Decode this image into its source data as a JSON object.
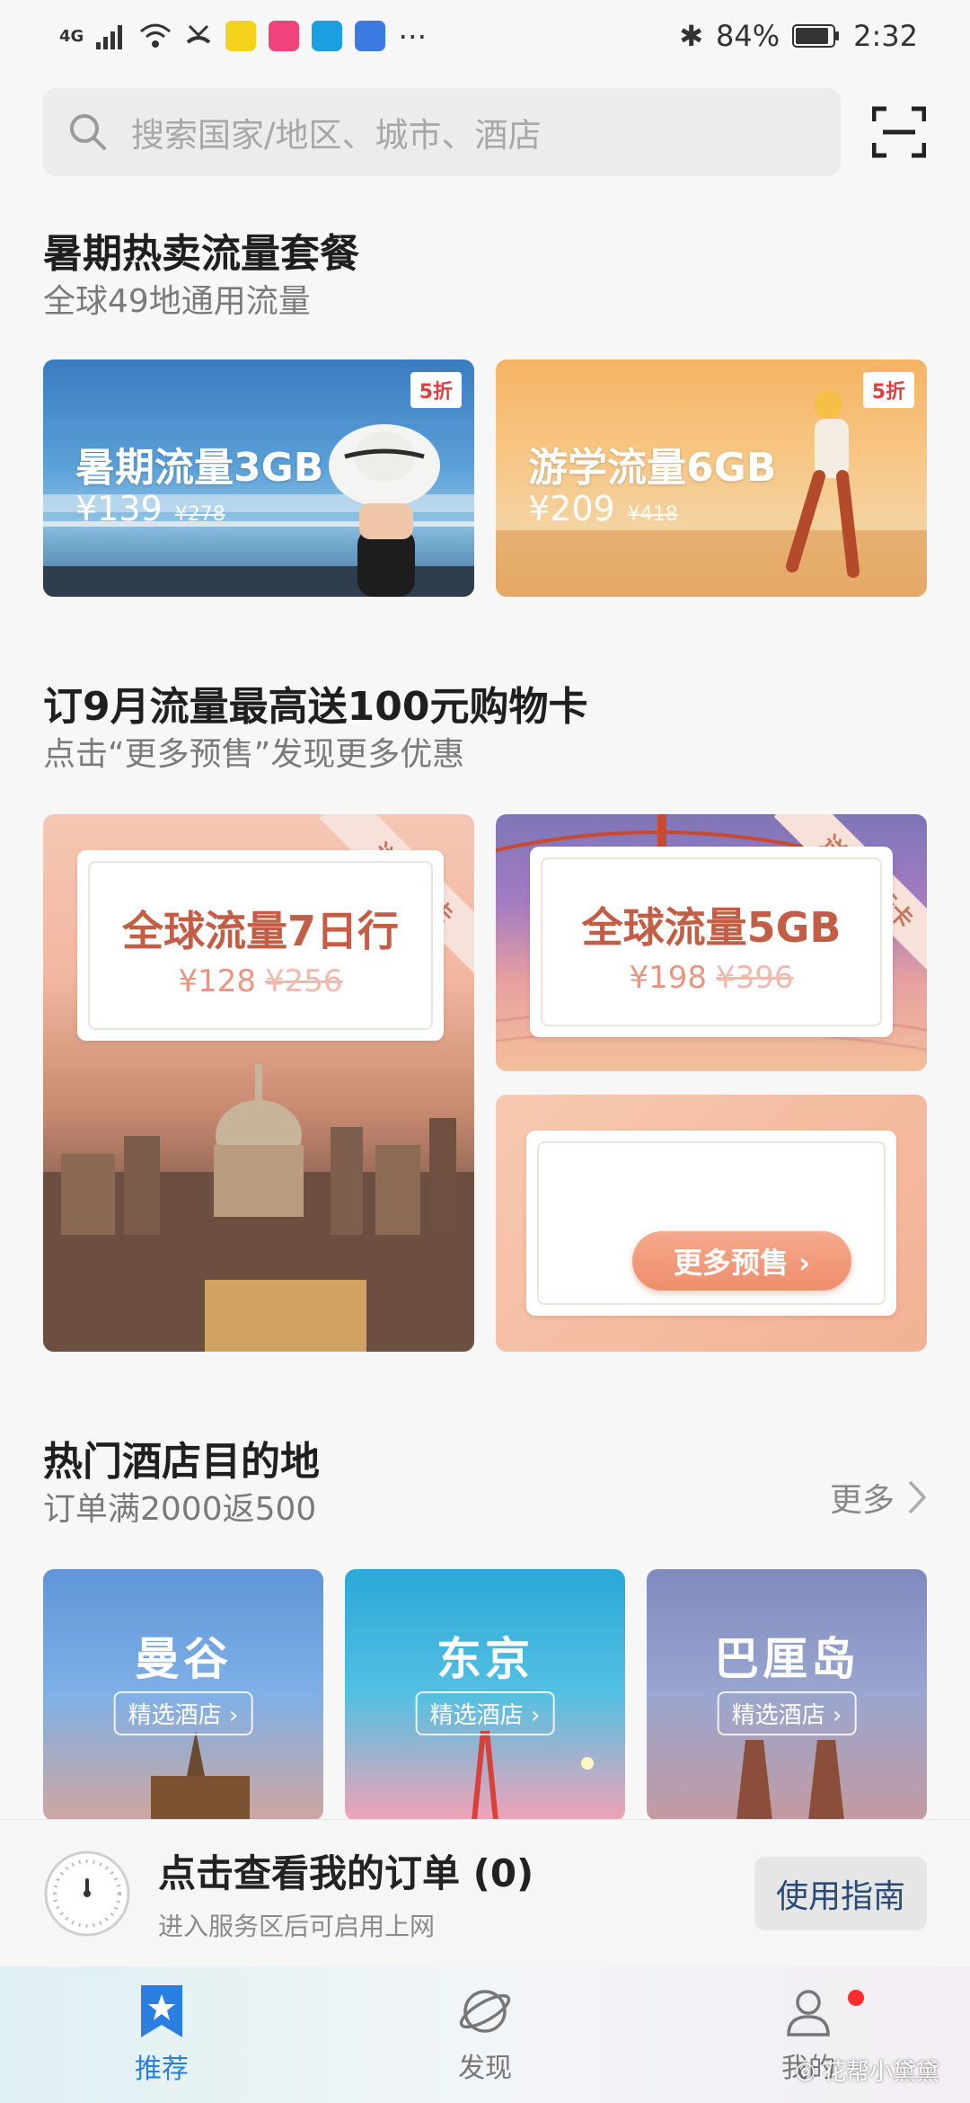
{
  "status": {
    "network": "4G",
    "battery": "84%",
    "time": "2:32"
  },
  "search": {
    "placeholder": "搜索国家/地区、城市、酒店"
  },
  "summer": {
    "title": "暑期热卖流量套餐",
    "subtitle": "全球49地通用流量",
    "cards": [
      {
        "badge": "5折",
        "name": "暑期流量3GB",
        "price": "¥139",
        "original": "¥278"
      },
      {
        "badge": "5折",
        "name": "游学流量6GB",
        "price": "¥209",
        "original": "¥418"
      }
    ]
  },
  "presale": {
    "title": "订9月流量最高送100元购物卡",
    "subtitle": "点击“更多预售”发现更多优惠",
    "cards": [
      {
        "ribbon": "送50元卡",
        "name": "全球流量7日行",
        "price": "¥128",
        "original": "¥256"
      },
      {
        "ribbon": "送100元卡",
        "name": "全球流量5GB",
        "price": "¥198",
        "original": "¥396"
      }
    ],
    "more_label": "更多预售 ›"
  },
  "hotels": {
    "title": "热门酒店目的地",
    "subtitle": "订单满2000返500",
    "more": "更多",
    "cards": [
      {
        "city": "曼谷",
        "tag": "精选酒店 ›"
      },
      {
        "city": "东京",
        "tag": "精选酒店 ›"
      },
      {
        "city": "巴厘岛",
        "tag": "精选酒店 ›"
      }
    ]
  },
  "order": {
    "title": "点击查看我的订单 (0)",
    "subtitle": "进入服务区后可启用上网",
    "guide": "使用指南"
  },
  "tabs": [
    {
      "label": "推荐",
      "icon": "star-bookmark-icon",
      "active": true
    },
    {
      "label": "发现",
      "icon": "planet-icon",
      "active": false
    },
    {
      "label": "我的",
      "icon": "person-icon",
      "active": false
    }
  ],
  "watermark": "花帮小黛黛",
  "colors": {
    "accent": "#2b7fe0",
    "sale_text": "#c25e45",
    "badge_red": "#e04040"
  }
}
